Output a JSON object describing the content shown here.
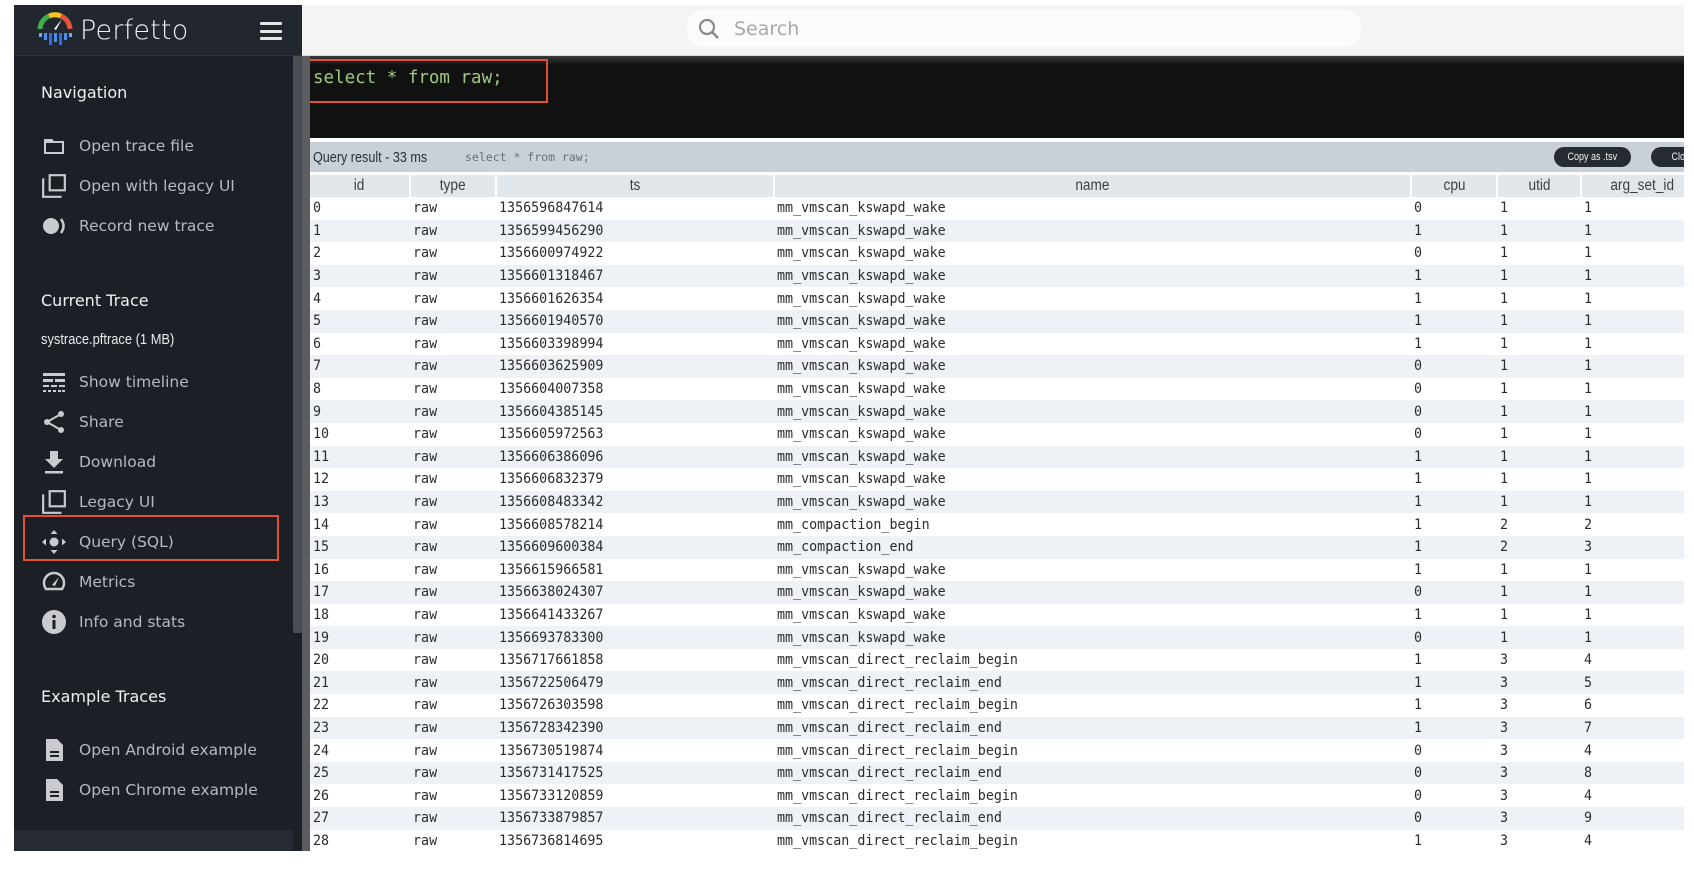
{
  "app": {
    "title": "Perfetto"
  },
  "sidebar": {
    "sections": [
      {
        "title": "Navigation",
        "items": [
          {
            "label": "Open trace file",
            "icon": "folder-icon"
          },
          {
            "label": "Open with legacy UI",
            "icon": "filter-none-icon"
          },
          {
            "label": "Record new trace",
            "icon": "record-icon"
          }
        ]
      },
      {
        "title": "Current Trace",
        "trace_name": "systrace.pftrace (1 MB)",
        "items": [
          {
            "label": "Show timeline",
            "icon": "timeline-icon"
          },
          {
            "label": "Share",
            "icon": "share-icon"
          },
          {
            "label": "Download",
            "icon": "download-icon"
          },
          {
            "label": "Legacy UI",
            "icon": "filter-none-icon"
          },
          {
            "label": "Query (SQL)",
            "icon": "control-camera-icon",
            "highlighted": true
          },
          {
            "label": "Metrics",
            "icon": "speed-icon"
          },
          {
            "label": "Info and stats",
            "icon": "info-icon"
          }
        ]
      },
      {
        "title": "Example Traces",
        "items": [
          {
            "label": "Open Android example",
            "icon": "description-icon"
          },
          {
            "label": "Open Chrome example",
            "icon": "description-icon"
          }
        ]
      }
    ]
  },
  "search": {
    "placeholder": "Search",
    "value": ""
  },
  "editor": {
    "query": "select * from raw;"
  },
  "result": {
    "title": "Query result - 33 ms",
    "query": "select * from raw;",
    "copy_label": "Copy as .tsv",
    "close_label": "Close",
    "columns": [
      "id",
      "type",
      "ts",
      "name",
      "cpu",
      "utid",
      "arg_set_id"
    ],
    "rows": [
      [
        "0",
        "raw",
        "1356596847614",
        "mm_vmscan_kswapd_wake",
        "0",
        "1",
        "1"
      ],
      [
        "1",
        "raw",
        "1356599456290",
        "mm_vmscan_kswapd_wake",
        "1",
        "1",
        "1"
      ],
      [
        "2",
        "raw",
        "1356600974922",
        "mm_vmscan_kswapd_wake",
        "0",
        "1",
        "1"
      ],
      [
        "3",
        "raw",
        "1356601318467",
        "mm_vmscan_kswapd_wake",
        "1",
        "1",
        "1"
      ],
      [
        "4",
        "raw",
        "1356601626354",
        "mm_vmscan_kswapd_wake",
        "1",
        "1",
        "1"
      ],
      [
        "5",
        "raw",
        "1356601940570",
        "mm_vmscan_kswapd_wake",
        "1",
        "1",
        "1"
      ],
      [
        "6",
        "raw",
        "1356603398994",
        "mm_vmscan_kswapd_wake",
        "1",
        "1",
        "1"
      ],
      [
        "7",
        "raw",
        "1356603625909",
        "mm_vmscan_kswapd_wake",
        "0",
        "1",
        "1"
      ],
      [
        "8",
        "raw",
        "1356604007358",
        "mm_vmscan_kswapd_wake",
        "0",
        "1",
        "1"
      ],
      [
        "9",
        "raw",
        "1356604385145",
        "mm_vmscan_kswapd_wake",
        "0",
        "1",
        "1"
      ],
      [
        "10",
        "raw",
        "1356605972563",
        "mm_vmscan_kswapd_wake",
        "0",
        "1",
        "1"
      ],
      [
        "11",
        "raw",
        "1356606386096",
        "mm_vmscan_kswapd_wake",
        "1",
        "1",
        "1"
      ],
      [
        "12",
        "raw",
        "1356606832379",
        "mm_vmscan_kswapd_wake",
        "1",
        "1",
        "1"
      ],
      [
        "13",
        "raw",
        "1356608483342",
        "mm_vmscan_kswapd_wake",
        "1",
        "1",
        "1"
      ],
      [
        "14",
        "raw",
        "1356608578214",
        "mm_compaction_begin",
        "1",
        "2",
        "2"
      ],
      [
        "15",
        "raw",
        "1356609600384",
        "mm_compaction_end",
        "1",
        "2",
        "3"
      ],
      [
        "16",
        "raw",
        "1356615966581",
        "mm_vmscan_kswapd_wake",
        "1",
        "1",
        "1"
      ],
      [
        "17",
        "raw",
        "1356638024307",
        "mm_vmscan_kswapd_wake",
        "0",
        "1",
        "1"
      ],
      [
        "18",
        "raw",
        "1356641433267",
        "mm_vmscan_kswapd_wake",
        "1",
        "1",
        "1"
      ],
      [
        "19",
        "raw",
        "1356693783300",
        "mm_vmscan_kswapd_wake",
        "0",
        "1",
        "1"
      ],
      [
        "20",
        "raw",
        "1356717661858",
        "mm_vmscan_direct_reclaim_begin",
        "1",
        "3",
        "4"
      ],
      [
        "21",
        "raw",
        "1356722506479",
        "mm_vmscan_direct_reclaim_end",
        "1",
        "3",
        "5"
      ],
      [
        "22",
        "raw",
        "1356726303598",
        "mm_vmscan_direct_reclaim_begin",
        "1",
        "3",
        "6"
      ],
      [
        "23",
        "raw",
        "1356728342390",
        "mm_vmscan_direct_reclaim_end",
        "1",
        "3",
        "7"
      ],
      [
        "24",
        "raw",
        "1356730519874",
        "mm_vmscan_direct_reclaim_begin",
        "0",
        "3",
        "4"
      ],
      [
        "25",
        "raw",
        "1356731417525",
        "mm_vmscan_direct_reclaim_end",
        "0",
        "3",
        "8"
      ],
      [
        "26",
        "raw",
        "1356733120859",
        "mm_vmscan_direct_reclaim_begin",
        "0",
        "3",
        "4"
      ],
      [
        "27",
        "raw",
        "1356733879857",
        "mm_vmscan_direct_reclaim_end",
        "0",
        "3",
        "9"
      ],
      [
        "28",
        "raw",
        "1356736814695",
        "mm_vmscan_direct_reclaim_begin",
        "1",
        "3",
        "4"
      ]
    ]
  },
  "colors": {
    "sidebar_bg": "#1c1f26",
    "highlight": "#e0532e",
    "sql_text": "#9ecb79",
    "result_bar": "#c9d0d8"
  }
}
